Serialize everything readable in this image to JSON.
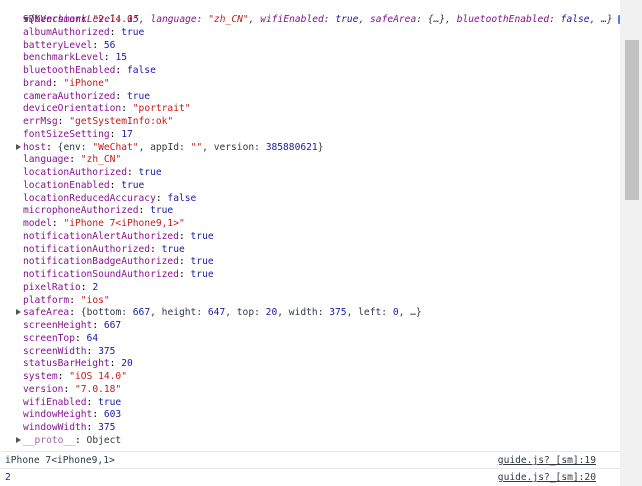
{
  "preview": {
    "open": "{",
    "k1": "benchmarkLevel",
    "v1": "15",
    "k2": "language",
    "v2": "\"zh_CN\"",
    "k3": "wifiEnabled",
    "v3": "true",
    "k4": "safeArea",
    "v4": "{…}",
    "k5": "bluetoothEnabled",
    "v5": "false",
    "tail": ", …}",
    "badge": "i"
  },
  "props": [
    {
      "key": "SDKVersion",
      "value": "\"2.14.0\"",
      "kind": "string"
    },
    {
      "key": "albumAuthorized",
      "value": "true",
      "kind": "bool"
    },
    {
      "key": "batteryLevel",
      "value": "56",
      "kind": "number"
    },
    {
      "key": "benchmarkLevel",
      "value": "15",
      "kind": "number"
    },
    {
      "key": "bluetoothEnabled",
      "value": "false",
      "kind": "bool"
    },
    {
      "key": "brand",
      "value": "\"iPhone\"",
      "kind": "string"
    },
    {
      "key": "cameraAuthorized",
      "value": "true",
      "kind": "bool"
    },
    {
      "key": "deviceOrientation",
      "value": "\"portrait\"",
      "kind": "string"
    },
    {
      "key": "errMsg",
      "value": "\"getSystemInfo:ok\"",
      "kind": "string"
    },
    {
      "key": "fontSizeSetting",
      "value": "17",
      "kind": "number"
    },
    {
      "key": "host",
      "kind": "object",
      "expandable": true
    },
    {
      "key": "language",
      "value": "\"zh_CN\"",
      "kind": "string"
    },
    {
      "key": "locationAuthorized",
      "value": "true",
      "kind": "bool"
    },
    {
      "key": "locationEnabled",
      "value": "true",
      "kind": "bool"
    },
    {
      "key": "locationReducedAccuracy",
      "value": "false",
      "kind": "bool"
    },
    {
      "key": "microphoneAuthorized",
      "value": "true",
      "kind": "bool"
    },
    {
      "key": "model",
      "value": "\"iPhone 7<iPhone9,1>\"",
      "kind": "string"
    },
    {
      "key": "notificationAlertAuthorized",
      "value": "true",
      "kind": "bool"
    },
    {
      "key": "notificationAuthorized",
      "value": "true",
      "kind": "bool"
    },
    {
      "key": "notificationBadgeAuthorized",
      "value": "true",
      "kind": "bool"
    },
    {
      "key": "notificationSoundAuthorized",
      "value": "true",
      "kind": "bool"
    },
    {
      "key": "pixelRatio",
      "value": "2",
      "kind": "number"
    },
    {
      "key": "platform",
      "value": "\"ios\"",
      "kind": "string"
    },
    {
      "key": "safeArea",
      "kind": "object",
      "expandable": true
    },
    {
      "key": "screenHeight",
      "value": "667",
      "kind": "number"
    },
    {
      "key": "screenTop",
      "value": "64",
      "kind": "number"
    },
    {
      "key": "screenWidth",
      "value": "375",
      "kind": "number"
    },
    {
      "key": "statusBarHeight",
      "value": "20",
      "kind": "number"
    },
    {
      "key": "system",
      "value": "\"iOS 14.0\"",
      "kind": "string"
    },
    {
      "key": "version",
      "value": "\"7.0.18\"",
      "kind": "string"
    },
    {
      "key": "wifiEnabled",
      "value": "true",
      "kind": "bool"
    },
    {
      "key": "windowHeight",
      "value": "603",
      "kind": "number"
    },
    {
      "key": "windowWidth",
      "value": "375",
      "kind": "number"
    },
    {
      "key": "__proto__",
      "value": "Object",
      "kind": "proto",
      "expandable": true
    }
  ],
  "host": {
    "open": "{",
    "k1": "env",
    "v1": "\"WeChat\"",
    "k2": "appId",
    "v2": "\"\"",
    "k3": "version",
    "v3": "385880621",
    "close": "}"
  },
  "safeArea": {
    "open": "{",
    "k1": "bottom",
    "v1": "667",
    "k2": "height",
    "v2": "647",
    "k3": "top",
    "v3": "20",
    "k4": "width",
    "v4": "375",
    "k5": "left",
    "v5": "0",
    "close": ", …}"
  },
  "log1": {
    "text": "iPhone 7<iPhone9,1>",
    "source": "guide.js?_[sm]:19"
  },
  "log2": {
    "text": "2",
    "source": "guide.js?_[sm]:20"
  }
}
